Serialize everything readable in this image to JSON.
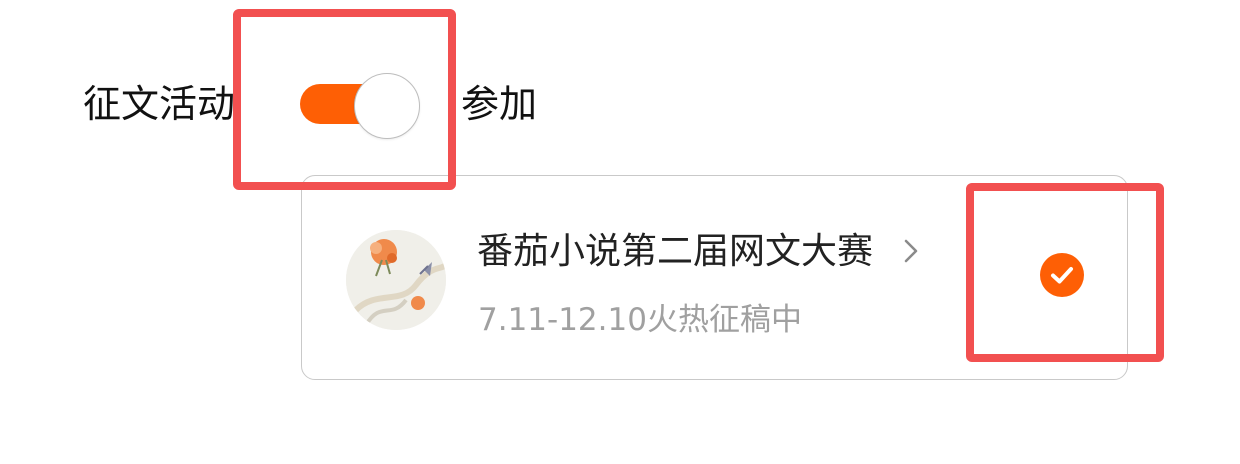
{
  "section": {
    "label": "征文活动"
  },
  "toggle": {
    "label": "参加",
    "state": "on"
  },
  "activity": {
    "title": "番茄小说第二届网文大赛",
    "subtitle": "7.11-12.10火热征稿中",
    "selected": true
  },
  "icons": {
    "chevron": "chevron-right-icon",
    "check": "check-circle-icon",
    "thumbnail": "flower-illustration"
  },
  "colors": {
    "accent": "#fe5f05",
    "highlight": "#f25050",
    "title_text": "#222222",
    "subtitle_text": "#a0a0a0",
    "card_border": "#c9c9c9"
  }
}
